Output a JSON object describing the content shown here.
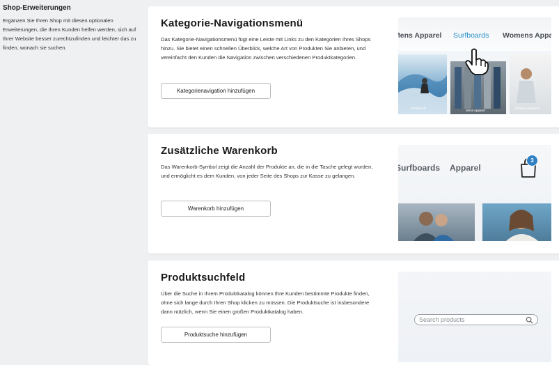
{
  "intro": {
    "title": "Shop-Erweiterungen",
    "description": "Ergänzen Sie Ihren Shop mit diesen optionalen Erweiterungen, die Ihren Kunden helfen werden, sich auf Ihrer Website besser zurechtzufinden und leichter das zu finden, wonach sie suchen."
  },
  "cards": [
    {
      "title": "Kategorie-Navigationsmenü",
      "description": "Das Kategorie-Navigationsmenü fügt eine Leiste mit Links zu den Kategorien Ihres Shops hinzu. Sie bietet einen schnellen Überblick, welche Art von Produkten Sie anbieten, und vereinfacht den Kunden die Navigation zwischen verschiedenen Produktkategorien.",
      "button": "Kategorienavigation hinzufügen",
      "preview": {
        "nav": [
          "Mens Apparel",
          "Surfboards",
          "Womens Apparel"
        ],
        "tiles": [
          "Surfboards",
          "Mens Apparel",
          "Womens Apparel"
        ]
      }
    },
    {
      "title": "Zusätzliche Warenkorb",
      "description": "Das Warenkorb-Symbol zeigt die Anzahl der Produkte an, die in die Tasche gelegt wurden, und ermöglicht es dem Kunden, von jeder Seite des Shops zur Kasse zu gelangen.",
      "button": "Warenkorb hinzufügen",
      "preview": {
        "nav": [
          "Surfboards",
          "Apparel"
        ],
        "cart_count": "3"
      }
    },
    {
      "title": "Produktsuchfeld",
      "description": "Über die Suche in Ihrem Produktkatalog können Ihre Kunden bestimmte Produkte finden, ohne sich lange durch Ihren Shop klicken zu müssen. Die Produktsuche ist insbesondere dann nützlich, wenn Sie einen großen Produktkatalog haben.",
      "button": "Produktsuche hinzufügen",
      "preview": {
        "search_placeholder": "Search products"
      }
    }
  ],
  "colors": {
    "accent": "#2a90c9",
    "badge": "#2e7fc4",
    "page_bg": "#eef0f2"
  }
}
